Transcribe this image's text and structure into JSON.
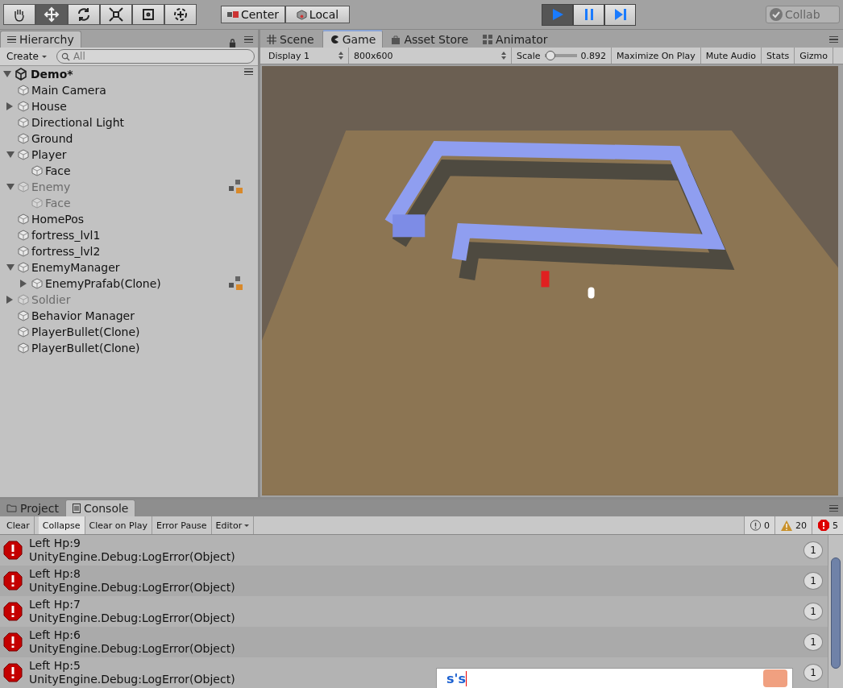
{
  "toolbar": {
    "tools": [
      {
        "kind": "hand",
        "selected": false
      },
      {
        "kind": "move",
        "selected": true
      },
      {
        "kind": "rotate",
        "selected": false
      },
      {
        "kind": "scale",
        "selected": false
      },
      {
        "kind": "rect",
        "selected": false
      },
      {
        "kind": "transform",
        "selected": false
      }
    ],
    "pivot": [
      {
        "kind": "pivot",
        "label": "Center"
      },
      {
        "kind": "space",
        "label": "Local"
      }
    ],
    "playback": [
      {
        "kind": "play",
        "on": true
      },
      {
        "kind": "pause",
        "on": false
      },
      {
        "kind": "step",
        "on": false
      }
    ],
    "collab": {
      "label": "Collab"
    }
  },
  "hierarchy": {
    "tab": {
      "label": "Hierarchy",
      "selected": true
    },
    "create": {
      "label": "Create"
    },
    "search": {
      "placeholder": "All"
    },
    "scene": {
      "label": "Demo*",
      "expanded": true
    },
    "items": [
      {
        "label": "Main Camera",
        "disabled": false,
        "prefab": false
      },
      {
        "label": "House",
        "disabled": false,
        "prefab": false,
        "expanded": false
      },
      {
        "label": "Directional Light",
        "disabled": false,
        "prefab": false
      },
      {
        "label": "Ground",
        "disabled": false,
        "prefab": false
      },
      {
        "label": "Player",
        "disabled": false,
        "prefab": false,
        "expanded": true,
        "children": [
          {
            "label": "Face",
            "disabled": false,
            "prefab": false
          }
        ]
      },
      {
        "label": "Enemy",
        "disabled": true,
        "prefab": true,
        "expanded": true,
        "children": [
          {
            "label": "Face",
            "disabled": true,
            "prefab": false
          }
        ]
      },
      {
        "label": "HomePos",
        "disabled": false,
        "prefab": false
      },
      {
        "label": "fortress_lvl1",
        "disabled": false,
        "prefab": false
      },
      {
        "label": "fortress_lvl2",
        "disabled": false,
        "prefab": false
      },
      {
        "label": "EnemyManager",
        "disabled": false,
        "prefab": false,
        "expanded": true,
        "children": [
          {
            "label": "EnemyPrafab(Clone)",
            "disabled": false,
            "prefab": true,
            "expanded": false
          }
        ]
      },
      {
        "label": "Soldier",
        "disabled": true,
        "prefab": false,
        "expanded": false
      },
      {
        "label": "Behavior Manager",
        "disabled": false,
        "prefab": false
      },
      {
        "label": "PlayerBullet(Clone)",
        "disabled": false,
        "prefab": false
      },
      {
        "label": "PlayerBullet(Clone)",
        "disabled": false,
        "prefab": false
      }
    ]
  },
  "view_tabs": [
    {
      "kind": "scene",
      "label": "Scene",
      "selected": false
    },
    {
      "kind": "game",
      "label": "Game",
      "selected": true
    },
    {
      "kind": "store",
      "label": "Asset Store",
      "selected": false
    },
    {
      "kind": "animator",
      "label": "Animator",
      "selected": false
    }
  ],
  "game_toolbar": {
    "display": "Display 1",
    "resolution": "800x600",
    "scale": {
      "label": "Scale",
      "level": 0.05,
      "reading": "0.892"
    },
    "toggles": [
      {
        "label": "Maximize On Play",
        "on": false
      },
      {
        "label": "Mute Audio",
        "on": false
      },
      {
        "label": "Stats",
        "on": false
      },
      {
        "label": "Gizmo",
        "on": false
      }
    ]
  },
  "console": {
    "tabs": [
      {
        "kind": "project",
        "label": "Project",
        "selected": false
      },
      {
        "kind": "console",
        "label": "Console",
        "selected": true
      }
    ],
    "buttons": [
      {
        "label": "Clear",
        "on": false
      },
      {
        "label": "Collapse",
        "on": true
      },
      {
        "label": "Clear on Play",
        "on": false
      },
      {
        "label": "Error Pause",
        "on": false
      },
      {
        "label": "Editor",
        "on": false,
        "dropdown": true
      }
    ],
    "counts": [
      {
        "kind": "info",
        "count": "0"
      },
      {
        "kind": "warning",
        "count": "20"
      },
      {
        "kind": "error",
        "count": "5"
      }
    ],
    "rows": [
      {
        "kind": "error",
        "message": "Left Hp:9",
        "trace": "UnityEngine.Debug:LogError(Object)",
        "count": "1"
      },
      {
        "kind": "error",
        "message": "Left Hp:8",
        "trace": "UnityEngine.Debug:LogError(Object)",
        "count": "1"
      },
      {
        "kind": "error",
        "message": "Left Hp:7",
        "trace": "UnityEngine.Debug:LogError(Object)",
        "count": "1"
      },
      {
        "kind": "error",
        "message": "Left Hp:6",
        "trace": "UnityEngine.Debug:LogError(Object)",
        "count": "1"
      },
      {
        "kind": "error",
        "message": "Left Hp:5",
        "trace": "UnityEngine.Debug:LogError(Object)",
        "count": "1"
      }
    ]
  },
  "ime": {
    "text": "s's"
  }
}
